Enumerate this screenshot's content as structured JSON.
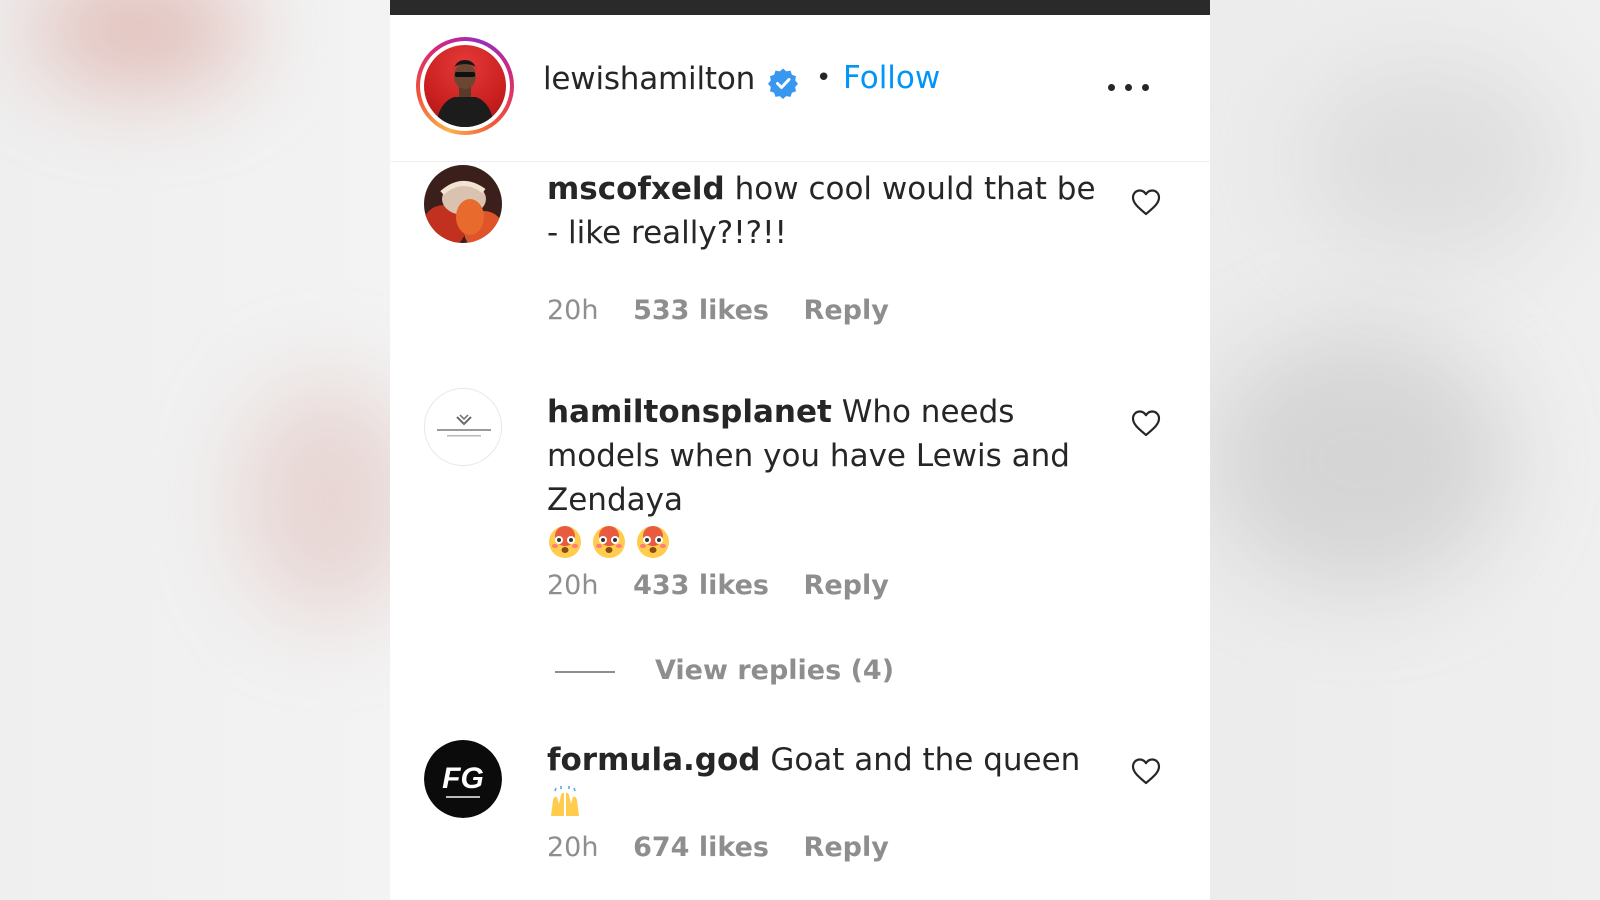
{
  "post_header": {
    "username": "lewishamilton",
    "verified": true,
    "separator": "•",
    "follow_label": "Follow",
    "more_icon": "more-options-icon"
  },
  "comments": [
    {
      "username": "mscofxeld",
      "text": "how cool would that be - like really?!?!!",
      "time": "20h",
      "likes": "533 likes",
      "reply_label": "Reply"
    },
    {
      "username": "hamiltonsplanet",
      "text": "Who needs models when you have Lewis and Zendaya",
      "emojis": [
        "flushed-face-emoji",
        "flushed-face-emoji",
        "flushed-face-emoji"
      ],
      "time": "20h",
      "likes": "433 likes",
      "reply_label": "Reply",
      "view_replies": "View replies (4)"
    },
    {
      "username": "formula.god",
      "text": "Goat and the queen",
      "emojis": [
        "raising-hands-emoji"
      ],
      "time": "20h",
      "likes": "674 likes",
      "reply_label": "Reply",
      "avatar_logo": "FG"
    }
  ],
  "colors": {
    "link_blue": "#0095f6",
    "verified_blue": "#3897f0",
    "text_primary": "#262626",
    "text_secondary": "#8e8e8e",
    "top_bar": "#2a2a2a"
  }
}
